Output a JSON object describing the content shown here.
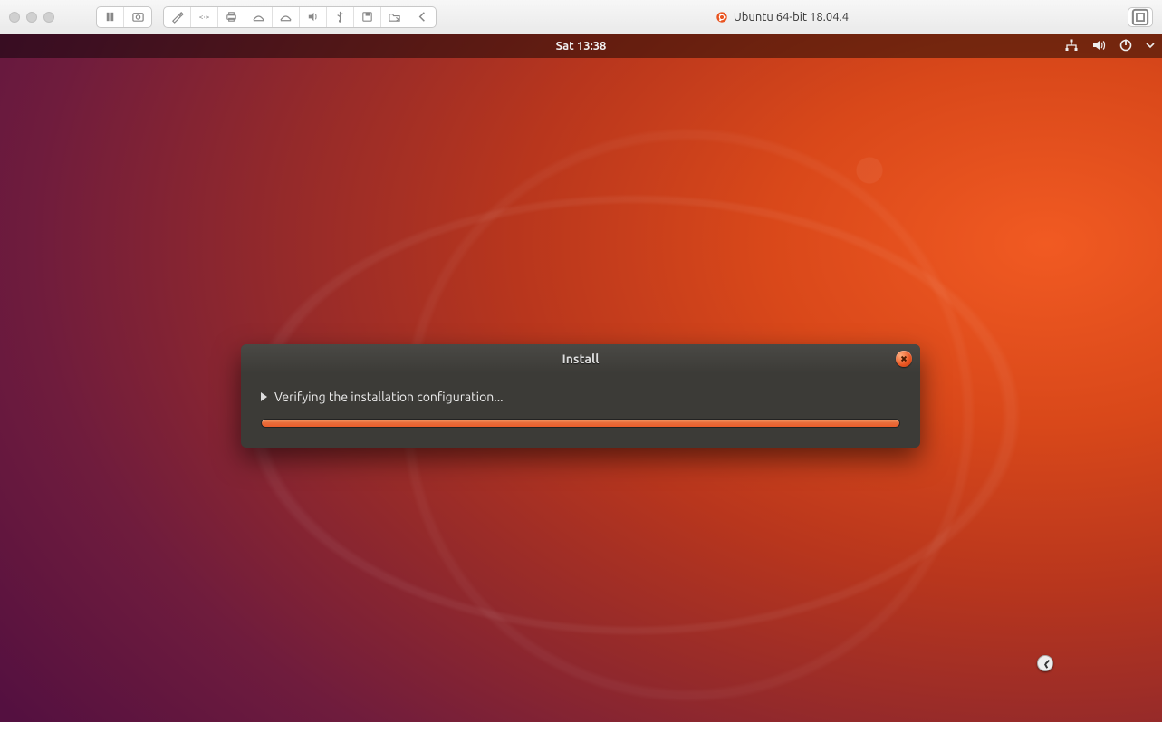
{
  "vm": {
    "title": "Ubuntu 64-bit 18.04.4"
  },
  "menubar": {
    "clock": "Sat 13:38"
  },
  "install": {
    "title": "Install",
    "status_text": "Verifying the installation configuration...",
    "progress_percent": 100
  },
  "icons": {
    "network": "network-icon",
    "volume": "volume-icon",
    "power": "power-icon",
    "dropdown": "chevron-down-icon",
    "close": "close-icon",
    "ubuntu": "ubuntu-logo-icon",
    "fullscreen": "fullscreen-icon"
  },
  "colors": {
    "ubuntu_orange": "#e95420",
    "dialog_bg": "#3c3b37"
  }
}
